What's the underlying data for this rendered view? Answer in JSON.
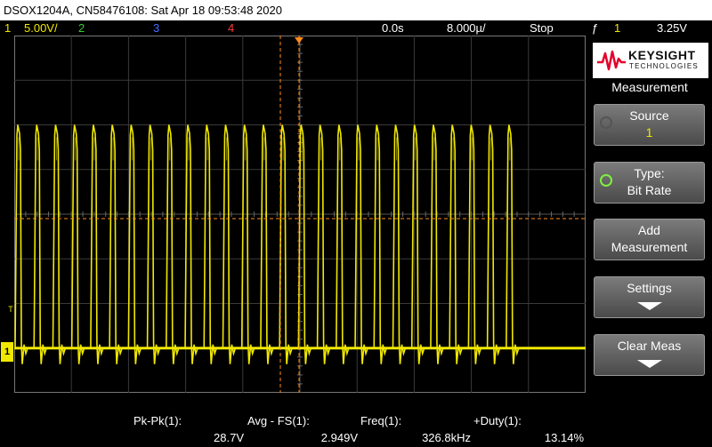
{
  "window": {
    "title": "DSOX1204A, CN58476108: Sat Apr 18 09:53:48 2020"
  },
  "status": {
    "ch1_number": "1",
    "ch1_scale": "5.00V/",
    "ch2_number": "2",
    "ch3_number": "3",
    "ch4_number": "4",
    "time_delay": "0.0s",
    "time_base": "8.000µ/",
    "run_state": "Stop",
    "trigger_symbol": "ƒ",
    "trigger_channel": "1",
    "trigger_level": "3.25V"
  },
  "colors": {
    "ch1": "#f0e800",
    "ch2": "#33cc33",
    "ch3": "#4a6cff",
    "ch4": "#ff3a3a",
    "trigger": "#ff8c1a",
    "keysight_red": "#e4002b"
  },
  "scope": {
    "trigger_marker": "T",
    "channel_marker": "1"
  },
  "brand": {
    "name": "KEYSIGHT",
    "tagline": "TECHNOLOGIES"
  },
  "menu": {
    "title": "Measurement",
    "source_label": "Source",
    "source_value": "1",
    "type_label": "Type:",
    "type_value": "Bit Rate",
    "add_line1": "Add",
    "add_line2": "Measurement",
    "settings_label": "Settings",
    "clear_label": "Clear Meas"
  },
  "measurements": [
    {
      "label": "Pk-Pk(1):",
      "value": "28.7V"
    },
    {
      "label": "Avg - FS(1):",
      "value": "2.949V"
    },
    {
      "label": "Freq(1):",
      "value": "326.8kHz"
    },
    {
      "label": "+Duty(1):",
      "value": "13.14%"
    }
  ],
  "waveform": {
    "pulse_count": 27,
    "pulse_period_divisions": 0.3306,
    "high_level_divisions": 6.0,
    "low_level_divisions": 1.0,
    "trigger_level_divisions": 3.9
  }
}
